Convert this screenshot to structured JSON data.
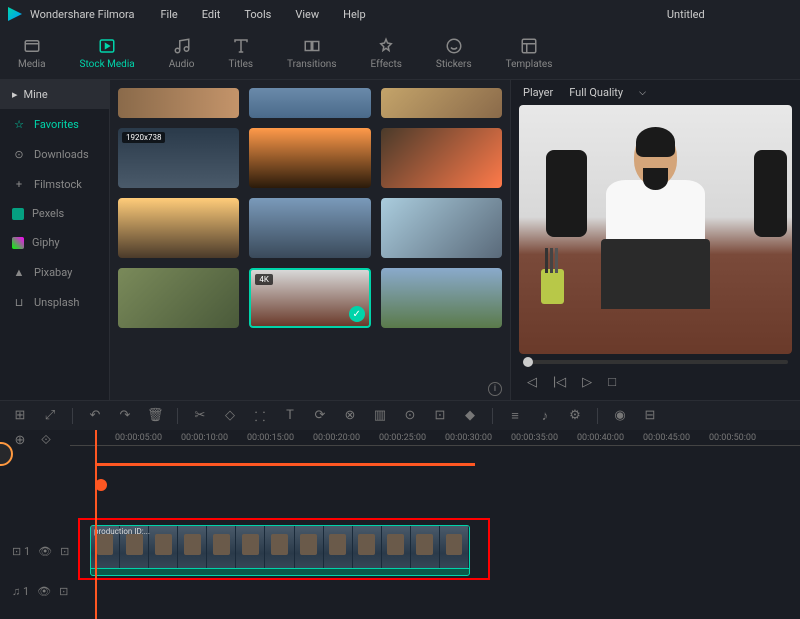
{
  "app": {
    "name": "Wondershare Filmora",
    "title": "Untitled"
  },
  "menu": [
    "File",
    "Edit",
    "Tools",
    "View",
    "Help"
  ],
  "toolbar": [
    {
      "id": "media",
      "label": "Media",
      "icon": "media"
    },
    {
      "id": "stock",
      "label": "Stock Media",
      "icon": "stock",
      "active": true
    },
    {
      "id": "audio",
      "label": "Audio",
      "icon": "audio"
    },
    {
      "id": "titles",
      "label": "Titles",
      "icon": "titles"
    },
    {
      "id": "transitions",
      "label": "Transitions",
      "icon": "transitions"
    },
    {
      "id": "effects",
      "label": "Effects",
      "icon": "effects"
    },
    {
      "id": "stickers",
      "label": "Stickers",
      "icon": "stickers"
    },
    {
      "id": "templates",
      "label": "Templates",
      "icon": "templates"
    }
  ],
  "sidebar": {
    "header": "Mine",
    "items": [
      {
        "label": "Favorites",
        "icon": "star",
        "active": true
      },
      {
        "label": "Downloads",
        "icon": "download"
      },
      {
        "label": "Filmstock",
        "icon": "plus"
      },
      {
        "label": "Pexels",
        "icon": "pexels"
      },
      {
        "label": "Giphy",
        "icon": "giphy"
      },
      {
        "label": "Pixabay",
        "icon": "pixabay"
      },
      {
        "label": "Unsplash",
        "icon": "unsplash"
      }
    ]
  },
  "thumbs": [
    {
      "bg": "linear-gradient(90deg,#8a6a4a,#c4946a)"
    },
    {
      "bg": "linear-gradient(180deg,#6a8aaa,#4a6a8a)"
    },
    {
      "bg": "linear-gradient(135deg,#c4a46a,#8a6a4a)"
    },
    {
      "bg": "linear-gradient(180deg,#2a3a4a,#4a5a6a)",
      "badge": "1920x738"
    },
    {
      "bg": "linear-gradient(180deg,#ff9a4a,#2a1a0a)"
    },
    {
      "bg": "linear-gradient(135deg,#4a3a2a,#ff7a4a)"
    },
    {
      "bg": "linear-gradient(180deg,#ffcc7a,#4a3a2a)"
    },
    {
      "bg": "linear-gradient(180deg,#7a9aba,#3a4a5a)"
    },
    {
      "bg": "linear-gradient(135deg,#aaccdd,#5a6a7a)"
    },
    {
      "bg": "linear-gradient(135deg,#7a8a5a,#4a5a3a)"
    },
    {
      "bg": "linear-gradient(180deg,#d8d8d8,#6a3a2a)",
      "selected": true,
      "badge": "4K"
    },
    {
      "bg": "linear-gradient(180deg,#8aaacc,#5a7a4a)"
    }
  ],
  "preview": {
    "tab1": "Player",
    "tab2": "Full Quality"
  },
  "timecodes": [
    "00:00:05:00",
    "00:00:10:00",
    "00:00:15:00",
    "00:00:20:00",
    "00:00:25:00",
    "00:00:30:00",
    "00:00:35:00",
    "00:00:40:00",
    "00:00:45:00",
    "00:00:50:00"
  ],
  "tracks": {
    "video": "⊡ 1",
    "audio": "♫ 1"
  },
  "clip_label": "production ID:..."
}
